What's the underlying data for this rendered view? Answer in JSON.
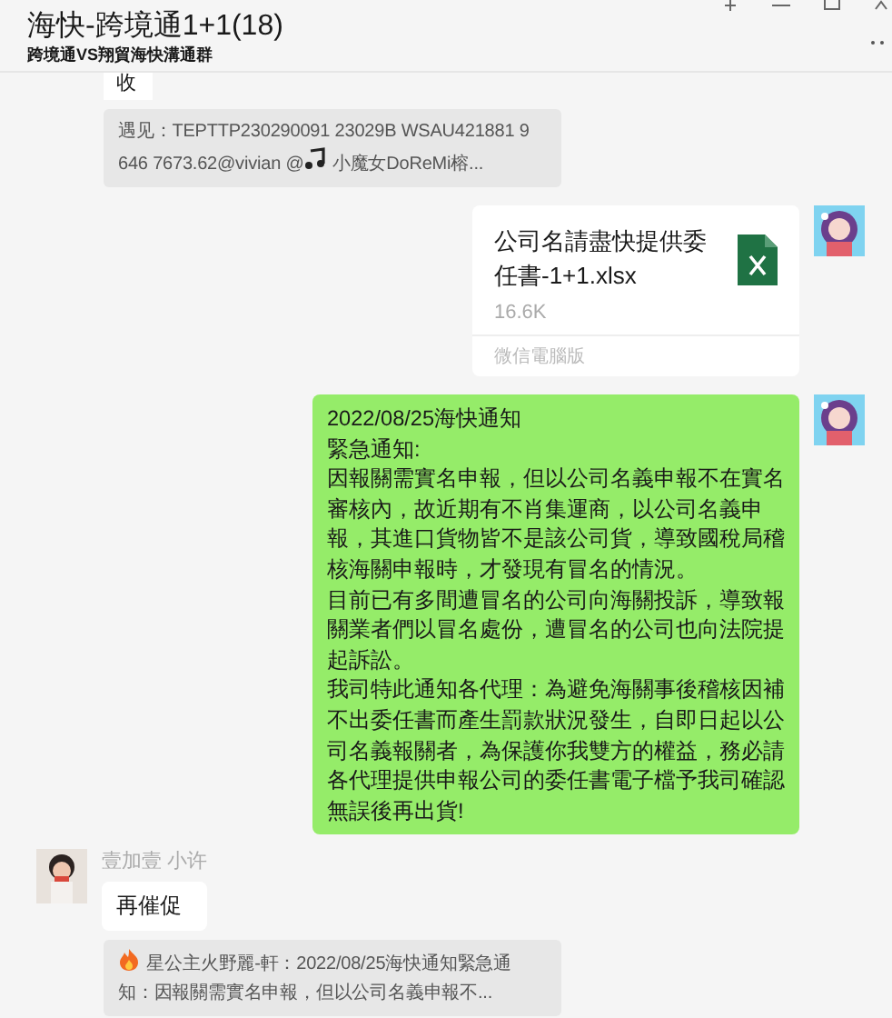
{
  "window": {
    "title": "海快-跨境通1+1(18)",
    "subtitle": "跨境通VS翔貿海快溝通群"
  },
  "messages": [
    {
      "kind": "partial",
      "text": "收"
    },
    {
      "kind": "music_quote",
      "text_before": "遇见：TEPTTP230290091 23029B WSAU421881 9 646 7673.62@vivian @",
      "text_after": " 小魔女DoReMi榕..."
    },
    {
      "kind": "sent_file",
      "filename": "公司名請盡快提供委任書-1+1.xlsx",
      "size": "16.6K",
      "source": "微信電腦版"
    },
    {
      "kind": "sent_text",
      "color": "#95ec69",
      "lines": [
        "2022/08/25海快通知",
        "緊急通知:",
        "因報關需實名申報，但以公司名義申報不在實名審核內，故近期有不肖集運商，以公司名義申報，其進口貨物皆不是該公司貨，導致國稅局稽核海關申報時，才發現有冒名的情況。",
        "目前已有多間遭冒名的公司向海關投訴，導致報關業者們以冒名處份，遭冒名的公司也向法院提起訴訟。",
        "我司特此通知各代理：為避免海關事後稽核因補不出委任書而產生罰款狀況發生，自即日起以公司名義報關者，為保護你我雙方的權益，務必請各代理提供申報公司的委任書電子檔予我司確認無誤後再出貨!"
      ]
    },
    {
      "kind": "received_text",
      "sender": "壹加壹 小许",
      "color": "#ffffff",
      "lines": [
        "再催促"
      ]
    },
    {
      "kind": "fire_quote",
      "text_after": " 星公主火野麗-軒：2022/08/25海快通知緊急通知：因報關需實名申報，但以公司名義申報不..."
    }
  ]
}
